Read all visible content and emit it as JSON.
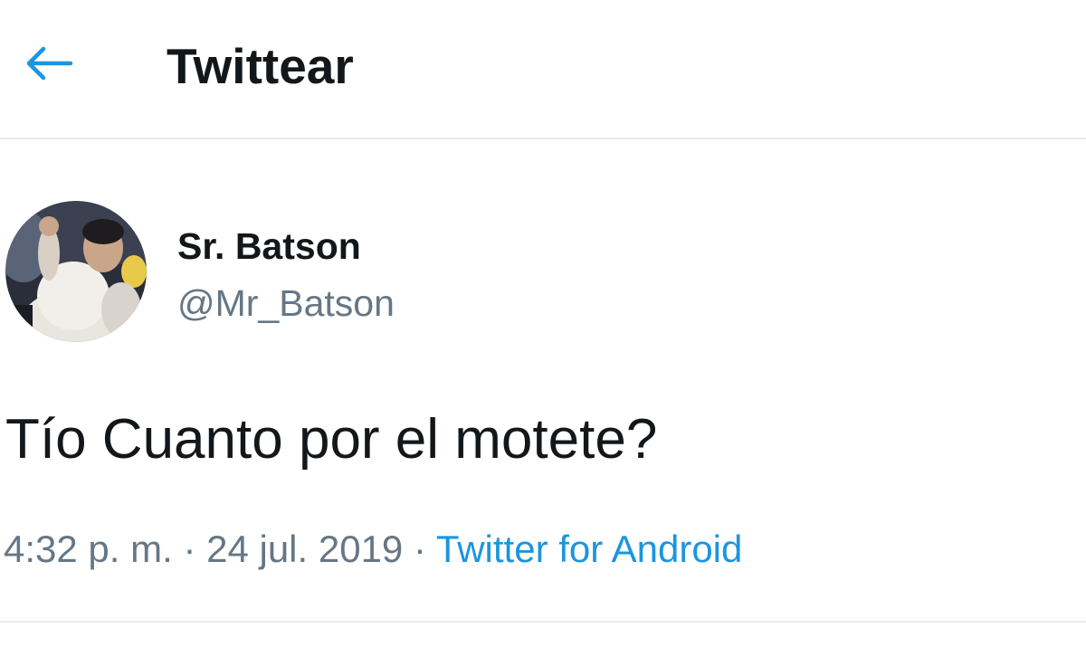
{
  "header": {
    "back_icon": "arrow-left-icon",
    "title": "Twittear"
  },
  "tweet": {
    "author": {
      "name": "Sr. Batson",
      "handle": "@Mr_Batson",
      "avatar": "user-avatar-photo"
    },
    "text": "Tío Cuanto por el motete?",
    "time": "4:32 p. m.",
    "separator": "·",
    "date": "24 jul. 2019",
    "source": "Twitter for Android"
  },
  "colors": {
    "accent": "#1b95e0",
    "text_primary": "#14171a",
    "text_secondary": "#657786",
    "divider": "#e6ecf0"
  }
}
